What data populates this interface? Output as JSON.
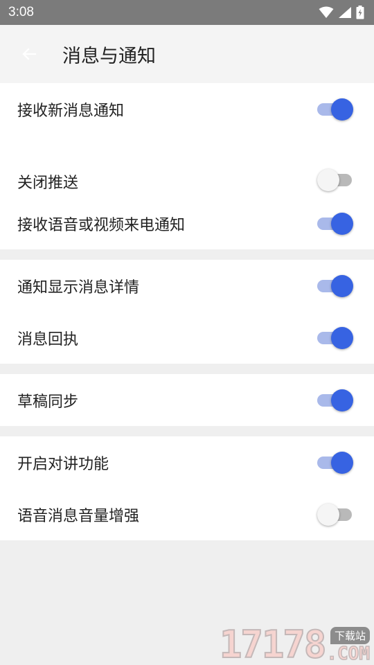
{
  "status_bar": {
    "time": "3:08",
    "icons": [
      "wifi-icon",
      "signal-icon",
      "battery-charging-icon"
    ]
  },
  "toolbar": {
    "back_icon": "arrow-back-icon",
    "title": "消息与通知"
  },
  "groups": [
    {
      "items": [
        {
          "label": "接收新消息通知",
          "enabled": true
        },
        {
          "label": "关闭推送",
          "enabled": false
        },
        {
          "label": "接收语音或视频来电通知",
          "enabled": true
        }
      ]
    },
    {
      "items": [
        {
          "label": "通知显示消息详情",
          "enabled": true
        },
        {
          "label": "消息回执",
          "enabled": true
        }
      ]
    },
    {
      "items": [
        {
          "label": "草稿同步",
          "enabled": true
        }
      ]
    },
    {
      "items": [
        {
          "label": "开启对讲功能",
          "enabled": true
        },
        {
          "label": "语音消息音量增强",
          "enabled": false
        }
      ]
    }
  ],
  "watermark": {
    "number": "17178",
    "badge": "下载站",
    "suffix": ".COM"
  },
  "colors": {
    "accent": "#3763e2",
    "accent_track": "#a9b9ea",
    "status_bar": "#7b7b7b"
  }
}
